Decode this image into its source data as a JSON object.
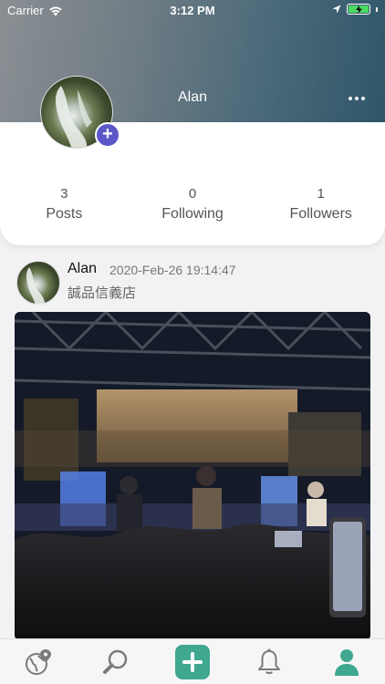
{
  "status_bar": {
    "carrier": "Carrier",
    "time": "3:12 PM"
  },
  "profile": {
    "name": "Alan",
    "stats": [
      {
        "count": "3",
        "label": "Posts"
      },
      {
        "count": "0",
        "label": "Following"
      },
      {
        "count": "1",
        "label": "Followers"
      }
    ]
  },
  "post": {
    "author": "Alan",
    "timestamp": "2020-Feb-26 19:14:47",
    "location": "誠品信義店"
  },
  "tab_bar": {
    "items": [
      {
        "icon": "map-globe-icon"
      },
      {
        "icon": "search-icon"
      },
      {
        "icon": "add-post-icon"
      },
      {
        "icon": "notifications-bell-icon"
      },
      {
        "icon": "profile-person-icon",
        "active": true
      }
    ],
    "accent_color": "#3fa88e",
    "inactive_color": "#7a7a7a"
  },
  "colors": {
    "avatar_add_badge": "#5b57c9",
    "header_gradient_end": "#2e5668"
  }
}
